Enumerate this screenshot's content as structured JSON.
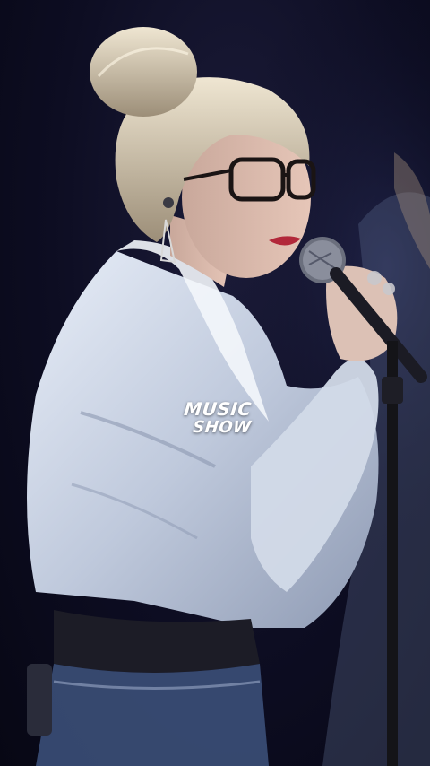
{
  "watermark": {
    "line1": "MUSIC",
    "line2": "SHOW"
  },
  "colors": {
    "background": "#0a0b1e",
    "shirt": "#c9d3e4",
    "hair": "#d8cdb6",
    "lips": "#b2283a"
  }
}
